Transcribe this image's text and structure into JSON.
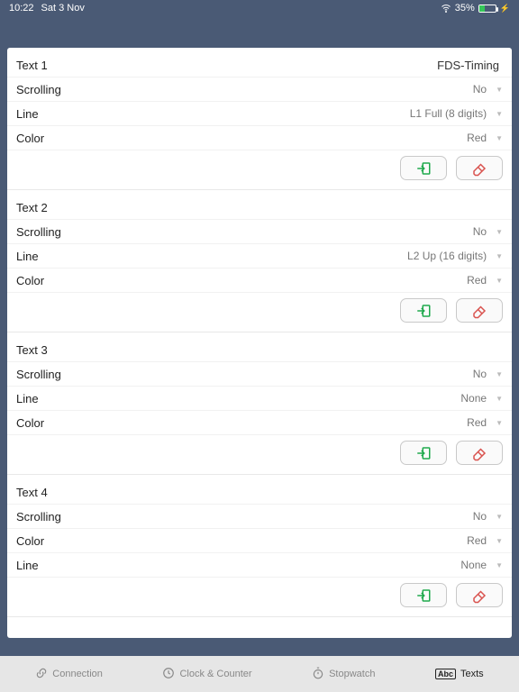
{
  "statusbar": {
    "time": "10:22",
    "date": "Sat 3 Nov",
    "battery_pct": "35%"
  },
  "sections": [
    {
      "title": "Text 1",
      "title_value": "FDS-Timing",
      "rows": [
        {
          "label": "Scrolling",
          "value": "No"
        },
        {
          "label": "Line",
          "value": "L1 Full (8  digits)"
        },
        {
          "label": "Color",
          "value": "Red"
        }
      ]
    },
    {
      "title": "Text 2",
      "title_value": "",
      "rows": [
        {
          "label": "Scrolling",
          "value": "No"
        },
        {
          "label": "Line",
          "value": "L2 Up   (16 digits)"
        },
        {
          "label": "Color",
          "value": "Red"
        }
      ]
    },
    {
      "title": "Text 3",
      "title_value": "",
      "rows": [
        {
          "label": "Scrolling",
          "value": "No"
        },
        {
          "label": "Line",
          "value": "None"
        },
        {
          "label": "Color",
          "value": "Red"
        }
      ]
    },
    {
      "title": "Text 4",
      "title_value": "",
      "rows": [
        {
          "label": "Scrolling",
          "value": "No"
        },
        {
          "label": "Color",
          "value": "Red"
        },
        {
          "label": "Line",
          "value": "None"
        }
      ]
    }
  ],
  "tabs": {
    "connection": "Connection",
    "clock": "Clock & Counter",
    "stopwatch": "Stopwatch",
    "texts": "Texts"
  }
}
